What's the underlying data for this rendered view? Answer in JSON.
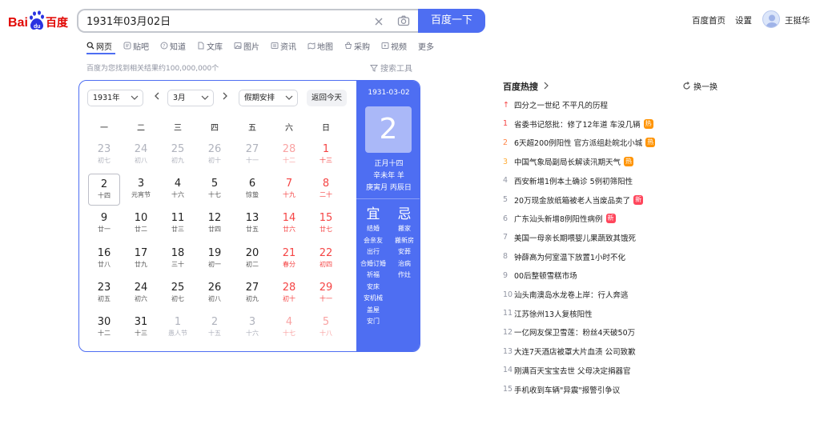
{
  "logo": {
    "text": "Bai百度",
    "colors": {
      "blue": "#2932e1",
      "red": "#e10602"
    }
  },
  "search": {
    "value": "1931年03月02日",
    "button": "百度一下"
  },
  "header": {
    "home": "百度首页",
    "settings": "设置",
    "user": "王挺华"
  },
  "tabs": [
    {
      "label": "网页",
      "icon": "search-icon",
      "active": true
    },
    {
      "label": "贴吧",
      "icon": "tieba-icon"
    },
    {
      "label": "知道",
      "icon": "zhidao-icon"
    },
    {
      "label": "文库",
      "icon": "wenku-icon"
    },
    {
      "label": "图片",
      "icon": "image-icon"
    },
    {
      "label": "资讯",
      "icon": "news-icon"
    },
    {
      "label": "地图",
      "icon": "map-icon"
    },
    {
      "label": "采购",
      "icon": "purchase-icon"
    },
    {
      "label": "视频",
      "icon": "video-icon"
    },
    {
      "label": "更多",
      "icon": ""
    }
  ],
  "results": {
    "info": "百度为您找到相关结果约100,000,000个",
    "tools": "搜索工具"
  },
  "calendar": {
    "year_select": "1931年",
    "month_select": "3月",
    "holiday_select": "假期安排",
    "today_button": "返回今天",
    "weekdays": [
      "一",
      "二",
      "三",
      "四",
      "五",
      "六",
      "日"
    ],
    "weeks": [
      [
        {
          "n": "23",
          "l": "初七",
          "g": 1
        },
        {
          "n": "24",
          "l": "初八",
          "g": 1
        },
        {
          "n": "25",
          "l": "初九",
          "g": 1
        },
        {
          "n": "26",
          "l": "初十",
          "g": 1
        },
        {
          "n": "27",
          "l": "十一",
          "g": 1
        },
        {
          "n": "28",
          "l": "十二",
          "g": 1,
          "r": 1
        },
        {
          "n": "1",
          "l": "十三",
          "r": 1
        }
      ],
      [
        {
          "n": "2",
          "l": "十四",
          "t": 1
        },
        {
          "n": "3",
          "l": "元宵节"
        },
        {
          "n": "4",
          "l": "十六"
        },
        {
          "n": "5",
          "l": "十七"
        },
        {
          "n": "6",
          "l": "惊蛰"
        },
        {
          "n": "7",
          "l": "十九",
          "r": 1
        },
        {
          "n": "8",
          "l": "二十",
          "r": 1
        }
      ],
      [
        {
          "n": "9",
          "l": "廿一"
        },
        {
          "n": "10",
          "l": "廿二"
        },
        {
          "n": "11",
          "l": "廿三"
        },
        {
          "n": "12",
          "l": "廿四"
        },
        {
          "n": "13",
          "l": "廿五"
        },
        {
          "n": "14",
          "l": "廿六",
          "r": 1
        },
        {
          "n": "15",
          "l": "廿七",
          "r": 1
        }
      ],
      [
        {
          "n": "16",
          "l": "廿八"
        },
        {
          "n": "17",
          "l": "廿九"
        },
        {
          "n": "18",
          "l": "三十"
        },
        {
          "n": "19",
          "l": "初一"
        },
        {
          "n": "20",
          "l": "初二"
        },
        {
          "n": "21",
          "l": "春分",
          "r": 1
        },
        {
          "n": "22",
          "l": "初四",
          "r": 1
        }
      ],
      [
        {
          "n": "23",
          "l": "初五"
        },
        {
          "n": "24",
          "l": "初六"
        },
        {
          "n": "25",
          "l": "初七"
        },
        {
          "n": "26",
          "l": "初八"
        },
        {
          "n": "27",
          "l": "初九"
        },
        {
          "n": "28",
          "l": "初十",
          "r": 1
        },
        {
          "n": "29",
          "l": "十一",
          "r": 1
        }
      ],
      [
        {
          "n": "30",
          "l": "十二"
        },
        {
          "n": "31",
          "l": "十三"
        },
        {
          "n": "1",
          "l": "愚人节",
          "g": 1
        },
        {
          "n": "2",
          "l": "十五",
          "g": 1
        },
        {
          "n": "3",
          "l": "十六",
          "g": 1
        },
        {
          "n": "4",
          "l": "十七",
          "g": 1,
          "r": 1
        },
        {
          "n": "5",
          "l": "十八",
          "g": 1,
          "r": 1
        }
      ]
    ],
    "side": {
      "date": "1931-03-02",
      "big": "2",
      "lunar": "正月十四",
      "ganzhi": "辛未年 羊",
      "detail": "庚寅月 丙辰日",
      "yi_title": "宜",
      "yi": [
        "结婚",
        "会亲友",
        "出行",
        "合婚订婚",
        "祈福",
        "安床",
        "安机械",
        "盖屋",
        "安门"
      ],
      "ji_title": "忌",
      "ji": [
        "搬家",
        "搬新房",
        "安葬",
        "治病",
        "作灶"
      ]
    }
  },
  "hot": {
    "title": "百度热搜",
    "refresh": "换一换",
    "items": [
      {
        "rank": "↑",
        "title": "四分之一世纪 不平凡的历程",
        "cls": "r1"
      },
      {
        "rank": "1",
        "title": "省委书记怒批：修了12年道 车没几辆",
        "badge": "热",
        "bc": "#ff9404",
        "cls": "r1"
      },
      {
        "rank": "2",
        "title": "6天超200例阳性 官方派组赴皖北小城",
        "badge": "热",
        "bc": "#ff9404",
        "cls": "r2"
      },
      {
        "rank": "3",
        "title": "中国气象局副局长解读汛期天气",
        "badge": "热",
        "bc": "#ff9404",
        "cls": "r3"
      },
      {
        "rank": "4",
        "title": "西安新增1例本土确诊 5例初筛阳性"
      },
      {
        "rank": "5",
        "title": "20万现金放纸箱被老人当废品卖了",
        "badge": "新",
        "bc": "#ff455b"
      },
      {
        "rank": "6",
        "title": "广东汕头新增8例阳性病例",
        "badge": "新",
        "bc": "#ff455b"
      },
      {
        "rank": "7",
        "title": "美国一母亲长期喂婴儿果蔬致其饿死"
      },
      {
        "rank": "8",
        "title": "钟薛高为何室温下放置1小时不化"
      },
      {
        "rank": "9",
        "title": "00后整顿雪糕市场"
      },
      {
        "rank": "10",
        "title": "汕头南澳岛水龙卷上岸：行人奔逃"
      },
      {
        "rank": "11",
        "title": "江苏徐州13人复核阳性"
      },
      {
        "rank": "12",
        "title": "一亿网友保卫雪莲：粉丝4天破50万"
      },
      {
        "rank": "13",
        "title": "大连7天酒店被罩大片血渍 公司致歉"
      },
      {
        "rank": "14",
        "title": "刚满百天宝宝去世 父母决定捐器官"
      },
      {
        "rank": "15",
        "title": "手机收到车辆\"异震\"报警引争议"
      }
    ]
  }
}
